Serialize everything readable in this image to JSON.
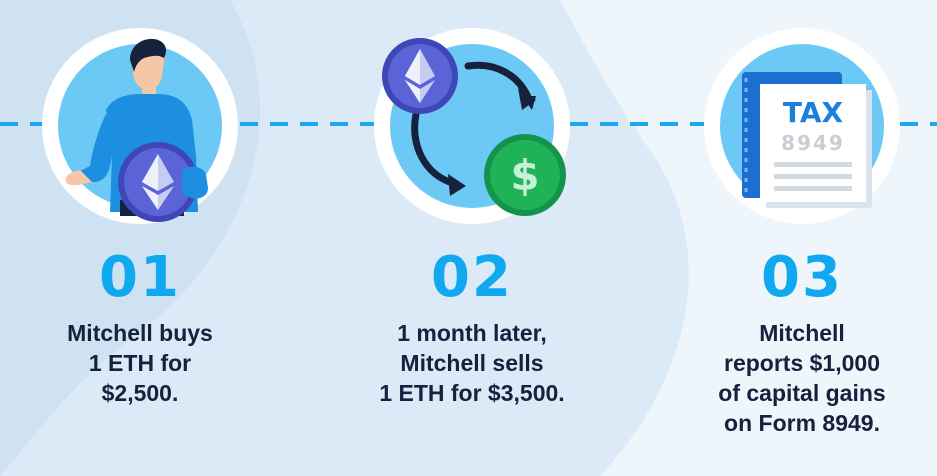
{
  "steps": [
    {
      "number": "01",
      "lines": [
        "Mitchell buys",
        "1 ETH for",
        "$2,500."
      ]
    },
    {
      "number": "02",
      "lines": [
        "1 month later,",
        "Mitchell sells",
        "1 ETH for $3,500."
      ]
    },
    {
      "number": "03",
      "lines": [
        "Mitchell",
        "reports $1,000",
        "of capital gains",
        "on Form 8949."
      ]
    }
  ],
  "tax_form": {
    "title": "TAX",
    "form_number": "8949"
  },
  "icons": {
    "step1": [
      "person-icon",
      "ethereum-coin-icon"
    ],
    "step2": [
      "ethereum-coin-icon",
      "exchange-arrows-icon",
      "dollar-coin-icon"
    ],
    "step3": [
      "tax-form-icon"
    ]
  },
  "colors": {
    "accent": "#10a9ef",
    "text": "#15213d",
    "circle": "#6cc9f6",
    "eth_coin": "#5a64d6",
    "dollar_coin": "#1fb257"
  }
}
